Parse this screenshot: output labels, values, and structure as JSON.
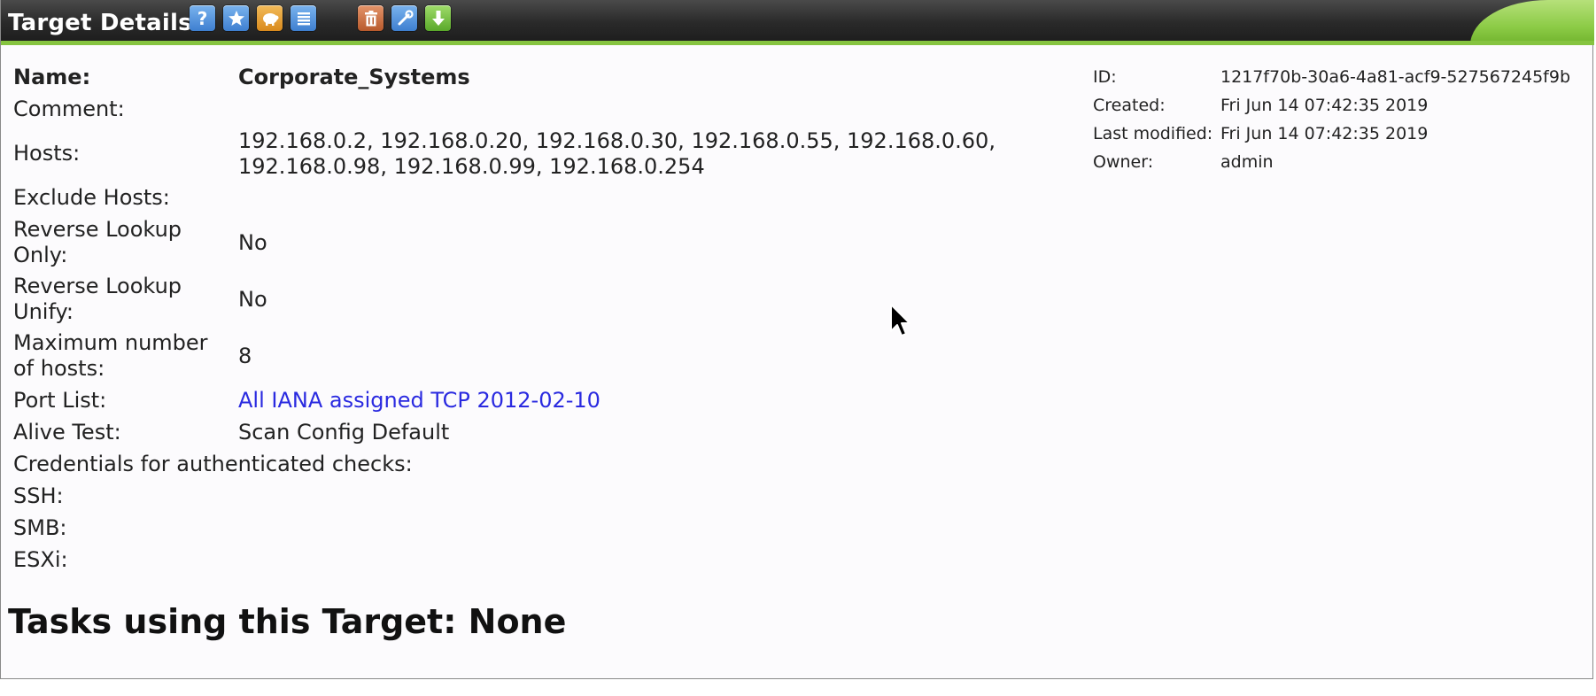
{
  "header": {
    "title": "Target Details",
    "icons": [
      "help-icon",
      "new-icon",
      "clone-icon",
      "list-icon",
      "trashcan-icon",
      "edit-icon",
      "export-icon"
    ]
  },
  "target": {
    "name_label": "Name:",
    "name_value": "Corporate_Systems",
    "comment_label": "Comment:",
    "comment_value": "",
    "hosts_label": "Hosts:",
    "hosts_line1": "192.168.0.2, 192.168.0.20, 192.168.0.30, 192.168.0.55, 192.168.0.60,",
    "hosts_line2": "192.168.0.98, 192.168.0.99, 192.168.0.254",
    "exclude_hosts_label": "Exclude Hosts:",
    "exclude_hosts_value": "",
    "reverse_lookup_only_label_1": "Reverse Lookup",
    "reverse_lookup_only_label_2": "Only:",
    "reverse_lookup_only_value": "No",
    "reverse_lookup_unify_label_1": "Reverse Lookup",
    "reverse_lookup_unify_label_2": "Unify:",
    "reverse_lookup_unify_value": "No",
    "max_hosts_label_1": "Maximum number",
    "max_hosts_label_2": "of hosts:",
    "max_hosts_value": "8",
    "port_list_label": "Port List:",
    "port_list_value": "All IANA assigned TCP 2012-02-10",
    "alive_test_label": "Alive Test:",
    "alive_test_value": "Scan Config Default",
    "credentials_label": "Credentials for authenticated checks:",
    "ssh_label": "SSH:",
    "smb_label": "SMB:",
    "esxi_label": "ESXi:"
  },
  "meta": {
    "id_label": "ID:",
    "id_value": "1217f70b-30a6-4a81-acf9-527567245f9b",
    "created_label": "Created:",
    "created_value": "Fri Jun 14 07:42:35 2019",
    "modified_label": "Last modified:",
    "modified_value": "Fri Jun 14 07:42:35 2019",
    "owner_label": "Owner:",
    "owner_value": "admin"
  },
  "tasks": {
    "heading": "Tasks using this Target: None"
  },
  "colors": {
    "header_bg": "#2a2a2a",
    "accent_green": "#86c440",
    "link_blue": "#2a2ae0"
  }
}
